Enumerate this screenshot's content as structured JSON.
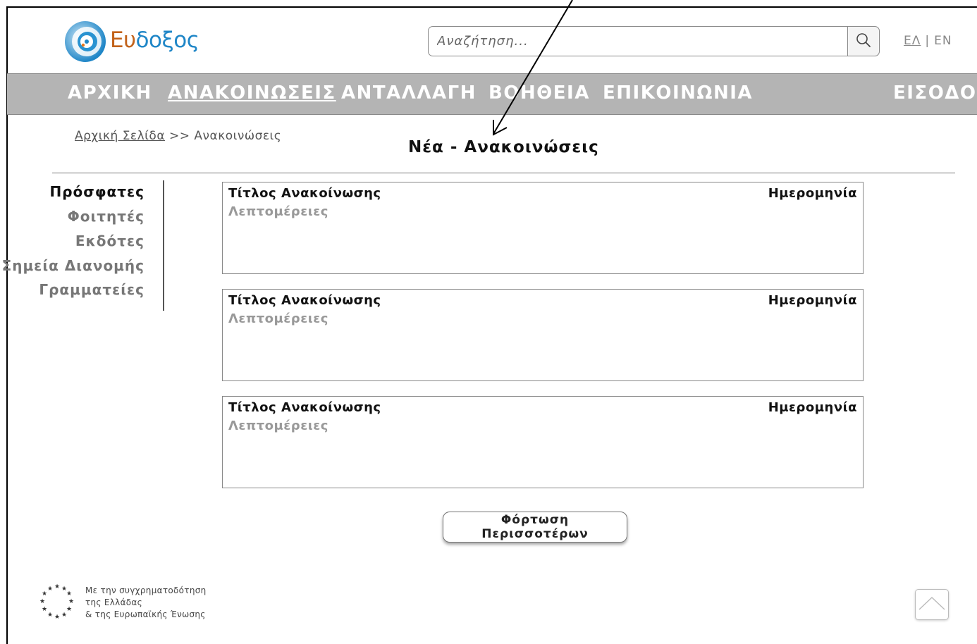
{
  "header": {
    "logo": {
      "text_part1": "Ευ",
      "text_part2": "δοξος",
      "colors": {
        "part1": "#c2621a",
        "part2": "#1f86c7"
      }
    },
    "search": {
      "placeholder": "Αναζήτηση...",
      "value": ""
    },
    "lang": {
      "greek": "ΕΛ",
      "separator": "|",
      "english": "EN"
    }
  },
  "nav": {
    "background": "#b4b4b4",
    "items": [
      {
        "label": "ΑΡΧΙΚΗ"
      },
      {
        "label": "ΑΝΑΚΟΙΝΩΣΕΙΣ",
        "active": true
      },
      {
        "label": "ΑΝΤΑΛΛΑΓΗ"
      },
      {
        "label": "ΒΟΗΘΕΙΑ"
      },
      {
        "label": "ΕΠΙΚΟΙΝΩΝΙΑ"
      },
      {
        "label": "ΕΙΣΟΔΟΣ"
      }
    ]
  },
  "breadcrumb": {
    "home": "Αρχική Σελίδα",
    "separator": ">>",
    "current": "Ανακοινώσεις"
  },
  "page_title": "Νέα - Ανακοινώσεις",
  "sidebar": {
    "items": [
      {
        "label": "Πρόσφατες",
        "active": true
      },
      {
        "label": "Φοιτητές"
      },
      {
        "label": "Εκδότες"
      },
      {
        "label": "Σημεία Διανομής"
      },
      {
        "label": "Γραμματείες"
      }
    ]
  },
  "announcements": [
    {
      "title": "Τίτλος Ανακοίνωσης",
      "date": "Ημερομηνία",
      "details": "Λεπτομέρειες"
    },
    {
      "title": "Τίτλος Ανακοίνωσης",
      "date": "Ημερομηνία",
      "details": "Λεπτομέρειες"
    },
    {
      "title": "Τίτλος Ανακοίνωσης",
      "date": "Ημερομηνία",
      "details": "Λεπτομέρειες"
    }
  ],
  "load_more_label": "Φόρτωση Περισσοτέρων",
  "footer": {
    "cofund_lines": [
      "Με την συγχρηματοδότηση",
      "της Ελλάδας",
      "& της Ευρωπαϊκής Ένωσης"
    ]
  },
  "icons": {
    "search": "search-icon",
    "scroll_top": "chevron-up-icon",
    "eu": "eu-stars-icon",
    "logo": "eudoxus-logo-icon"
  }
}
